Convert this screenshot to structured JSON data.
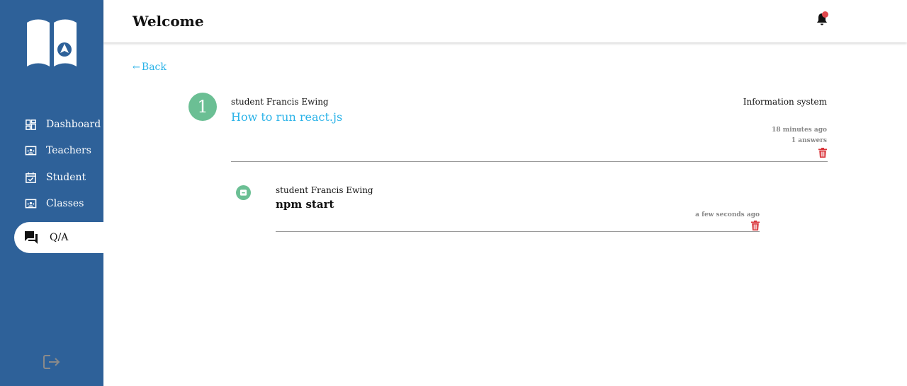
{
  "colors": {
    "sidebar": "#2e6199",
    "accent": "#2bb3e8",
    "badge": "#6bbf94",
    "danger": "#d9343a",
    "notification_dot": "#e0474c"
  },
  "sidebar": {
    "logo_icon": "open-book-logo-icon",
    "items": [
      {
        "label": "Dashboard",
        "icon": "dashboard-icon"
      },
      {
        "label": "Teachers",
        "icon": "teacher-board-icon"
      },
      {
        "label": "Student",
        "icon": "calendar-check-icon"
      },
      {
        "label": "Classes",
        "icon": "class-board-icon"
      },
      {
        "label": "Q/A",
        "icon": "forum-icon",
        "active": true
      }
    ],
    "logout_icon": "logout-icon"
  },
  "header": {
    "title": "Welcome",
    "notification_icon": "bell-icon"
  },
  "back": {
    "label": "Back",
    "arrow": "←"
  },
  "question": {
    "number": "1",
    "author": "student Francis Ewing",
    "title": "How to run react.js",
    "category": "Information system",
    "time": "18 minutes ago",
    "answers": "1 answers"
  },
  "answer": {
    "author": "student Francis Ewing",
    "text": "npm start",
    "time": "a few seconds ago"
  }
}
